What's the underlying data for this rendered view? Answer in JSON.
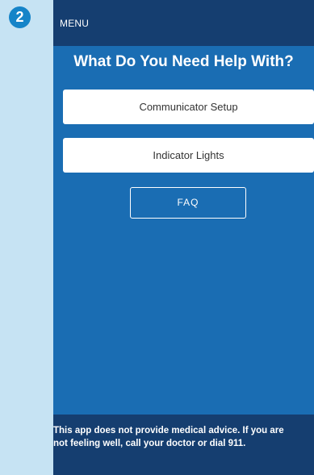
{
  "step_badge": "2",
  "topbar": {
    "menu_label": "MENU"
  },
  "main": {
    "heading": "What Do You Need Help With?",
    "buttons": [
      {
        "label": "Communicator Setup"
      },
      {
        "label": "Indicator Lights"
      }
    ],
    "faq_label": "FAQ"
  },
  "footer": {
    "disclaimer": "This app does not provide medical advice. If you are not feeling well, call your doctor or dial 911."
  },
  "colors": {
    "page_background": "#c6e3f3",
    "badge": "#1584c8",
    "screen_background": "#1a6db3",
    "header_footer": "#153e70",
    "button_background": "#ffffff"
  }
}
